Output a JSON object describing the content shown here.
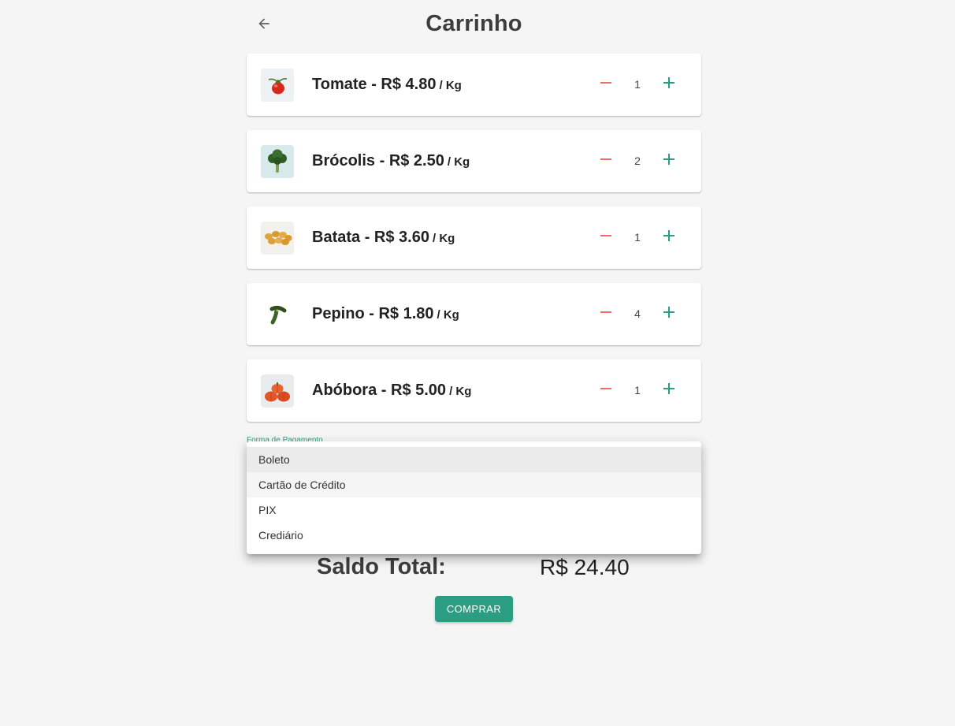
{
  "header": {
    "title": "Carrinho",
    "back_icon": "arrow-left-icon"
  },
  "cart": {
    "items": [
      {
        "name": "Tomate",
        "price_text": "R$ 4.80",
        "unit": "/ Kg",
        "quantity": "1",
        "image": "tomato"
      },
      {
        "name": "Brócolis",
        "price_text": "R$ 2.50",
        "unit": "/ Kg",
        "quantity": "2",
        "image": "broccoli"
      },
      {
        "name": "Batata",
        "price_text": "R$ 3.60",
        "unit": "/ Kg",
        "quantity": "1",
        "image": "potatoes"
      },
      {
        "name": "Pepino",
        "price_text": "R$ 1.80",
        "unit": "/ Kg",
        "quantity": "4",
        "image": "cucumber"
      },
      {
        "name": "Abóbora",
        "price_text": "R$ 5.00",
        "unit": "/ Kg",
        "quantity": "1",
        "image": "pumpkins"
      }
    ],
    "separator": " - ",
    "decrement_icon": "minus-icon",
    "increment_icon": "plus-icon"
  },
  "payment": {
    "label": "Forma de Pagamento",
    "options": [
      "Boleto",
      "Cartão de Crédito",
      "PIX",
      "Crediário"
    ],
    "selected": "Boleto",
    "hovered": "Cartão de Crédito"
  },
  "summary": {
    "total_label": "Saldo Total:",
    "total_value": "R$ 24.40"
  },
  "actions": {
    "buy_label": "COMPRAR"
  },
  "colors": {
    "accent": "#2a9d82",
    "minus": "#f26b6b",
    "plus": "#2a9d82",
    "background": "#f5f5f5"
  }
}
